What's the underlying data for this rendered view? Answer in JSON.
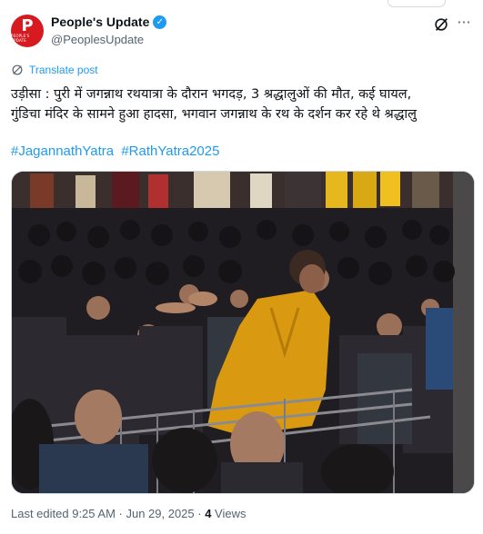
{
  "account": {
    "display_name": "People's Update",
    "handle": "@PeoplesUpdate",
    "avatar_letter": "P",
    "avatar_caption": "PEOPLE'S UPDATE",
    "verified_glyph": "✓"
  },
  "icons": {
    "grok": "grok-icon",
    "more": "more-icon",
    "translate": "translate-icon",
    "verified": "verified-badge-icon"
  },
  "translate_label": "Translate post",
  "post_lines": [
    "उड़ीसा : पुरी में जगन्नाथ रथयात्रा के दौरान भगदड़, 3 श्रद्धालुओं की मौत, कई घायल,",
    "गुंडिचा मंदिर के सामने हुआ हादसा, भगवान जगन्नाथ के रथ के दर्शन कर रहे थे श्रद्धालु"
  ],
  "hashtags": [
    "#JagannathYatra",
    "#RathYatra2025"
  ],
  "footer": {
    "edited": "Last edited 9:25 AM · Jun 29, 2025 · ",
    "views_count": "4",
    "views_label": " Views"
  },
  "colors": {
    "accent": "#1d9bf0",
    "avatar_bg": "#d71920",
    "text": "#0f1419",
    "muted": "#536471",
    "shirt_yellow": "#d99a12"
  },
  "more_glyph": "···"
}
